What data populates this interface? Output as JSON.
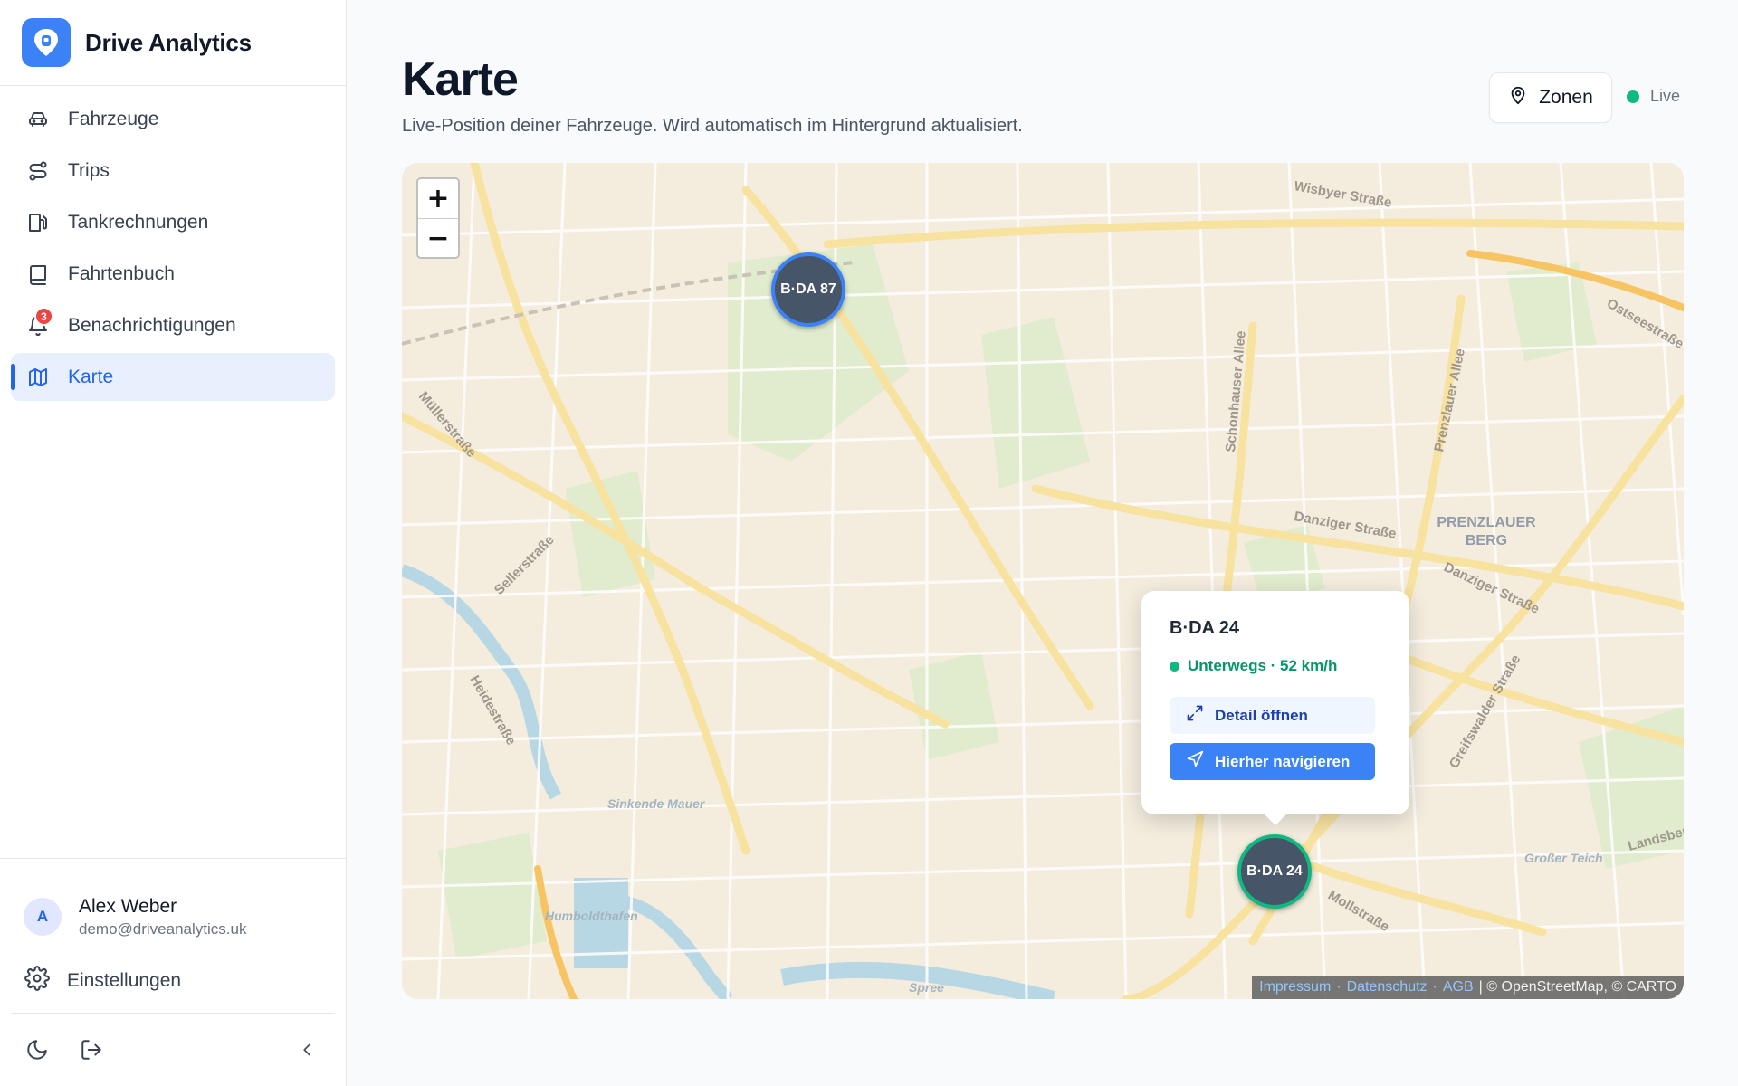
{
  "app": {
    "name": "Drive Analytics"
  },
  "sidebar": {
    "items": [
      {
        "label": "Fahrzeuge",
        "icon": "car-icon"
      },
      {
        "label": "Trips",
        "icon": "route-icon"
      },
      {
        "label": "Tankrechnungen",
        "icon": "fuel-icon"
      },
      {
        "label": "Fahrtenbuch",
        "icon": "book-icon"
      },
      {
        "label": "Benachrichtigungen",
        "icon": "bell-icon",
        "badge": "3"
      },
      {
        "label": "Karte",
        "icon": "map-icon",
        "active": true
      }
    ],
    "user": {
      "initial": "A",
      "name": "Alex Weber",
      "email": "demo@driveanalytics.uk"
    },
    "settings_label": "Einstellungen"
  },
  "page": {
    "title": "Karte",
    "subtitle": "Live-Position deiner Fahrzeuge. Wird automatisch im Hintergrund aktualisiert.",
    "zones_button": "Zonen",
    "live_label": "Live"
  },
  "map": {
    "zoom_in": "+",
    "zoom_out": "−",
    "street_labels": [
      "Wisbyer Straße",
      "Schonhauser Allee",
      "Prenzlauer Allee",
      "Danziger Straße",
      "Danziger Straße",
      "Müllerstraße",
      "Sellerstraße",
      "Heidestraße",
      "Greifswalder Straße",
      "Mollstraße",
      "Ostseestraße",
      "Sinkende Mauer",
      "Humboldthafen",
      "Spree",
      "Großer Teich",
      "PRENZLAUER",
      "BERG",
      "Landsberg"
    ],
    "markers": [
      {
        "label": "B·DA 87",
        "status_color": "#3b82f6"
      },
      {
        "label": "B·DA 24",
        "status_color": "#10b981"
      }
    ],
    "popup": {
      "title": "B·DA 24",
      "status": "Unterwegs · 52 km/h",
      "detail_button": "Detail öffnen",
      "navigate_button": "Hierher navigieren"
    },
    "attribution": {
      "impressum": "Impressum",
      "datenschutz": "Datenschutz",
      "agb": "AGB",
      "credits": "| © OpenStreetMap, © CARTO"
    }
  },
  "colors": {
    "accent": "#3b82f6",
    "success": "#10b981",
    "danger": "#ef4444"
  }
}
